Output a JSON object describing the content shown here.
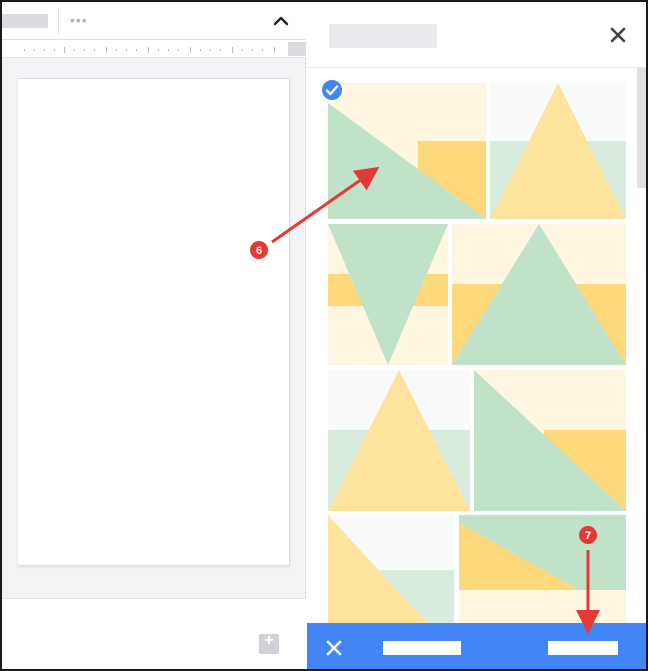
{
  "toolbar": {
    "more_glyph": "•••",
    "collapse_icon": "chevron-up-icon"
  },
  "panel": {
    "title": "",
    "close_icon": "close-icon"
  },
  "action_bar": {
    "cancel_icon": "close-icon",
    "label": "",
    "insert_label": ""
  },
  "steps": {
    "step_a": "6",
    "step_b": "7"
  },
  "colors": {
    "cream": "#fef6e0",
    "light_green": "#d7ecdc",
    "green": "#bfe2c9",
    "yellow": "#fde39c",
    "gold": "#fdd97b",
    "pale": "#f8fbf9",
    "accent_blue": "#4285f4",
    "annotation_red": "#e53935"
  }
}
